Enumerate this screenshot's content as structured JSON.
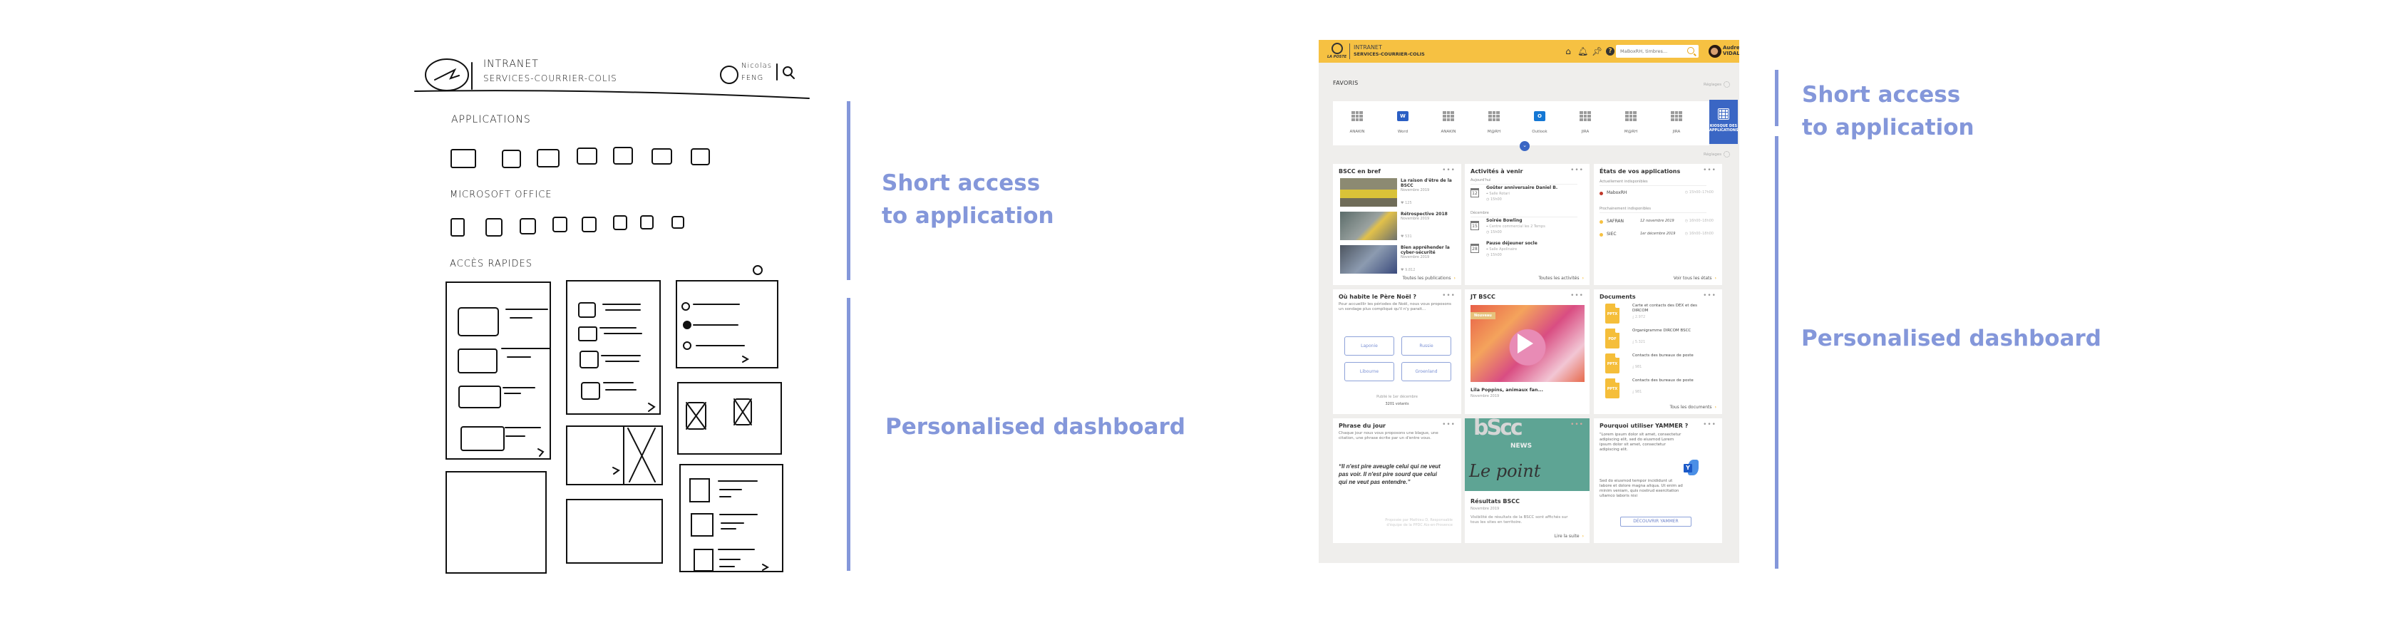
{
  "annotations": {
    "left": [
      {
        "label_line1": "Short access",
        "label_line2": "to application"
      },
      {
        "label_line1": "Personalised dashboard",
        "label_line2": ""
      }
    ],
    "right": [
      {
        "label_line1": "Short access",
        "label_line2": "to application"
      },
      {
        "label_line1": "Personalised dashboard",
        "label_line2": ""
      }
    ],
    "accent_color": "#8497da"
  },
  "sketch": {
    "header_line1": "INTRANET",
    "header_line2": "SERVICES-COURRIER-COLIS",
    "user_line1": "Nicolas",
    "user_line2": "FENG",
    "section_applications": "APPLICATIONS",
    "section_office": "MICROSOFT OFFICE",
    "section_quick": "ACCÈS RAPIDES"
  },
  "mockup": {
    "brand_color": "#f6c142",
    "header": {
      "logo_text": "LA POSTE",
      "title": "INTRANET",
      "subtitle": "SERVICES-COURRIER-COLIS",
      "icons": [
        "home-icon",
        "bell-icon",
        "pin-icon",
        "help-icon"
      ],
      "search_placeholder": "MaBoxRH, timbres...",
      "user_first": "Audrey",
      "user_last": "VIDAL"
    },
    "favorites": {
      "title": "FAVORIS",
      "settings_label": "Réglages",
      "items": [
        {
          "label": "ANAKIN",
          "icon": "grid"
        },
        {
          "label": "Word",
          "icon": "word"
        },
        {
          "label": "ANAKIN",
          "icon": "grid"
        },
        {
          "label": "M@RH",
          "icon": "grid"
        },
        {
          "label": "Outlook",
          "icon": "outlook"
        },
        {
          "label": "JIRA",
          "icon": "grid"
        },
        {
          "label": "M@RH",
          "icon": "grid"
        },
        {
          "label": "JIRA",
          "icon": "grid"
        }
      ],
      "kiosk_line1": "KIOSQUE DES",
      "kiosk_line2": "APPLICATIONS",
      "word_letter": "W",
      "outlook_letter": "O"
    },
    "dashboard_settings_label": "Réglages",
    "more_label": "•••",
    "bscc": {
      "title": "BSCC en bref",
      "items": [
        {
          "title": "La raison d'être de la BSCC",
          "date": "Novembre 2019",
          "likes": "125"
        },
        {
          "title": "Rétrospective 2018",
          "date": "Novembre 2019",
          "likes": "531"
        },
        {
          "title": "Bien appréhender la cyber-sécurité",
          "date": "Novembre 2019",
          "likes": "9.812"
        }
      ],
      "link": "Toutes les publications"
    },
    "activities": {
      "title": "Activités à venir",
      "groups": [
        {
          "label": "Aujourd'hui",
          "items": [
            {
              "day": "12",
              "title": "Goûter anniversaire Daniel B.",
              "place": "Salle Rotari",
              "time": "15h00"
            }
          ]
        },
        {
          "label": "Décembre",
          "items": [
            {
              "day": "15",
              "title": "Soirée Bowling",
              "place": "Centre commercial les 2 Temps",
              "time": "15h00"
            },
            {
              "day": "28",
              "title": "Pause déjeuner socle",
              "place": "Salle Apolinaire",
              "time": "15h00"
            }
          ]
        }
      ],
      "link": "Toutes les activités"
    },
    "app_states": {
      "title": "États de vos applications",
      "current_label": "Actuellement indisponibles",
      "current": [
        {
          "name": "MaboxRH",
          "date": "",
          "time": "15h00–17h00",
          "color": "#c0392b"
        }
      ],
      "upcoming_label": "Prochainement indisponibles",
      "upcoming": [
        {
          "name": "SAFRAN",
          "date": "12 novembre 2019",
          "time": "16h00–18h00",
          "color": "#f6c142"
        },
        {
          "name": "SIEC",
          "date": "1er décembre 2019",
          "time": "16h00–18h00",
          "color": "#f6c142"
        }
      ],
      "link": "Voir tous les états"
    },
    "poll": {
      "title": "Où habite le Père Noël ?",
      "description": "Pour accueillir les périodes de Noël, nous vous proposons un sondage plus compliqué qu'il n'y parait...",
      "options": [
        "Laponie",
        "Russie",
        "Libourne",
        "Groenland"
      ],
      "published": "Publié le 1er décembre",
      "voters": "3201 votants"
    },
    "jt": {
      "title": "JT BSCC",
      "badge": "Nouveau",
      "video_title": "Lila Poppins, animaux fan...",
      "date": "Novembre 2019"
    },
    "documents": {
      "title": "Documents",
      "items": [
        {
          "type": "PPTX",
          "title": "Carte et contacts des DEX et des DIRCOM",
          "downloads": "2.972"
        },
        {
          "type": "PDF",
          "title": "Organigramme DIRCOM BSCC",
          "downloads": "5.321"
        },
        {
          "type": "PPTX",
          "title": "Contacts des bureaux de poste",
          "downloads": "981"
        },
        {
          "type": "PPTX",
          "title": "Contacts des bureaux de poste",
          "downloads": "981"
        }
      ],
      "link": "Tous les documents"
    },
    "phrase": {
      "title": "Phrase du jour",
      "description": "Chaque jour nous vous proposons une blague, une citation, une phrase écrite par un d'entre vous.",
      "quote": "“Il n'est pire aveugle celui qui ne veut pas voir. Il n'est pire sourd que celui qui ne veut pas entendre.”",
      "author": "Proposée par Mathieu D, Responsable d'équipe de la PPDC Aix-en-Provence"
    },
    "news": {
      "logo": "bScc",
      "logo_sub": "NEWS",
      "script": "Le point",
      "title": "Résultats BSCC",
      "date": "Novembre 2019",
      "description": "Visibilité de résultats de la BSCC sont affichés sur tous les sites en territoire.",
      "link": "Lire la suite"
    },
    "yammer": {
      "title": "Pourquoi utiliser YAMMER ?",
      "text1": "\"Lorem ipsum dolor sit amet, consectetur adipiscing elit, sed do eiusmod Lorem ipsum dolor sit amet, consectetur adipiscing elit.",
      "text2": "Sed do eiusmod tempor incididunt ut labore et dolore magna aliqua. Ut enim ad minim veniam, quis nostrud exercitation ullamco laboris nisi",
      "icon_letter": "Y",
      "button": "DÉCOUVRIR YAMMER"
    }
  }
}
